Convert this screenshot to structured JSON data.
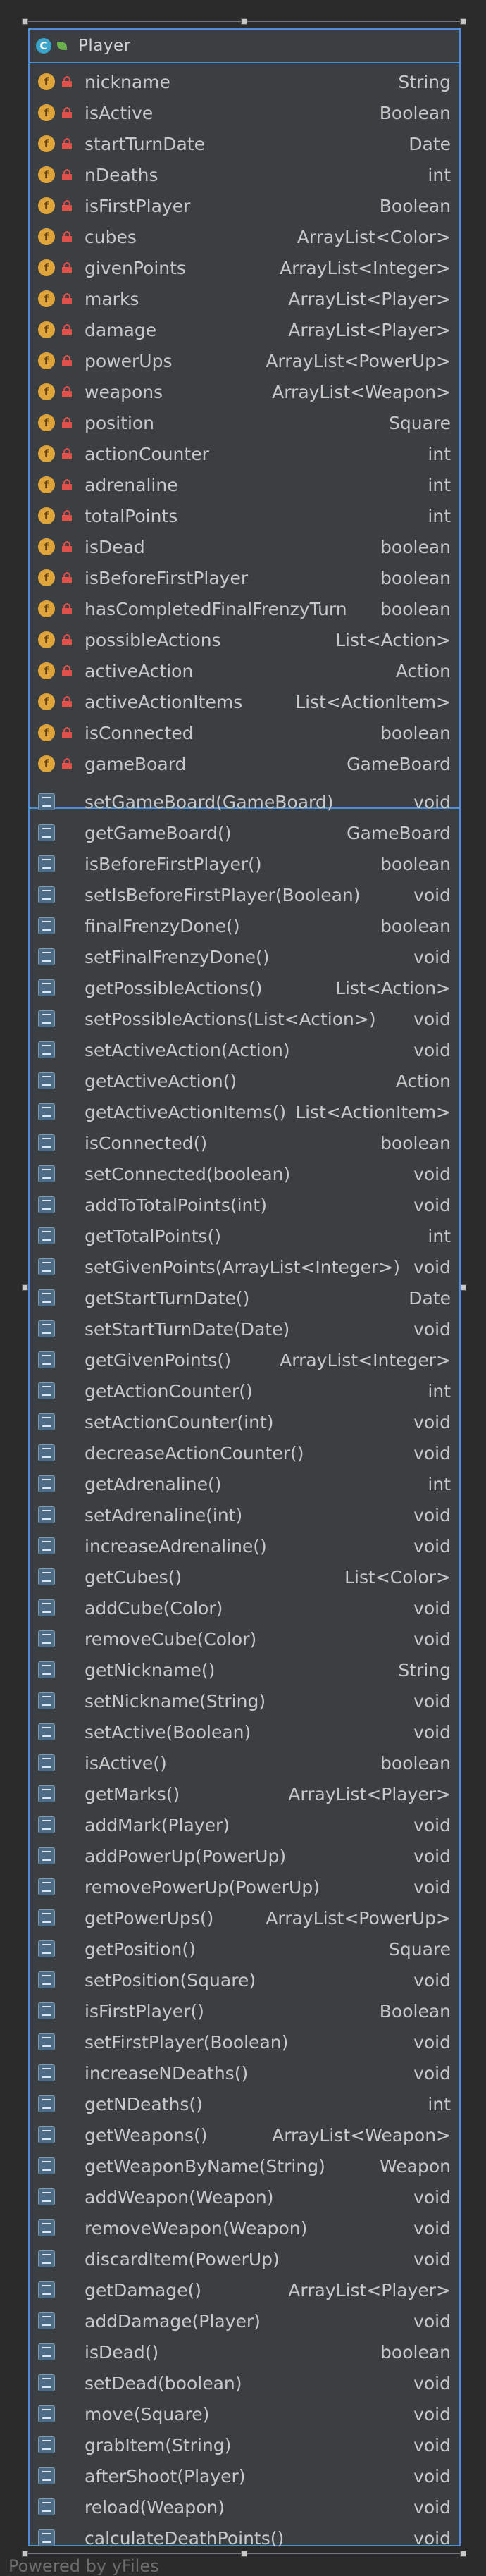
{
  "class": {
    "name": "Player",
    "icon": "class-icon",
    "fields": [
      {
        "name": "nickname",
        "type": "String"
      },
      {
        "name": "isActive",
        "type": "Boolean"
      },
      {
        "name": "startTurnDate",
        "type": "Date"
      },
      {
        "name": "nDeaths",
        "type": "int"
      },
      {
        "name": "isFirstPlayer",
        "type": "Boolean"
      },
      {
        "name": "cubes",
        "type": "ArrayList<Color>"
      },
      {
        "name": "givenPoints",
        "type": "ArrayList<Integer>"
      },
      {
        "name": "marks",
        "type": "ArrayList<Player>"
      },
      {
        "name": "damage",
        "type": "ArrayList<Player>"
      },
      {
        "name": "powerUps",
        "type": "ArrayList<PowerUp>"
      },
      {
        "name": "weapons",
        "type": "ArrayList<Weapon>"
      },
      {
        "name": "position",
        "type": "Square"
      },
      {
        "name": "actionCounter",
        "type": "int"
      },
      {
        "name": "adrenaline",
        "type": "int"
      },
      {
        "name": "totalPoints",
        "type": "int"
      },
      {
        "name": "isDead",
        "type": "boolean"
      },
      {
        "name": "isBeforeFirstPlayer",
        "type": "boolean"
      },
      {
        "name": "hasCompletedFinalFrenzyTurn",
        "type": "boolean"
      },
      {
        "name": "possibleActions",
        "type": "List<Action>"
      },
      {
        "name": "activeAction",
        "type": "Action"
      },
      {
        "name": "activeActionItems",
        "type": "List<ActionItem>"
      },
      {
        "name": "isConnected",
        "type": "boolean"
      },
      {
        "name": "gameBoard",
        "type": "GameBoard"
      }
    ],
    "methods": [
      {
        "name": "setGameBoard(GameBoard)",
        "type": "void"
      },
      {
        "name": "getGameBoard()",
        "type": "GameBoard"
      },
      {
        "name": "isBeforeFirstPlayer()",
        "type": "boolean"
      },
      {
        "name": "setIsBeforeFirstPlayer(Boolean)",
        "type": "void"
      },
      {
        "name": "finalFrenzyDone()",
        "type": "boolean"
      },
      {
        "name": "setFinalFrenzyDone()",
        "type": "void"
      },
      {
        "name": "getPossibleActions()",
        "type": "List<Action>"
      },
      {
        "name": "setPossibleActions(List<Action>)",
        "type": "void"
      },
      {
        "name": "setActiveAction(Action)",
        "type": "void"
      },
      {
        "name": "getActiveAction()",
        "type": "Action"
      },
      {
        "name": "getActiveActionItems()",
        "type": "List<ActionItem>"
      },
      {
        "name": "isConnected()",
        "type": "boolean"
      },
      {
        "name": "setConnected(boolean)",
        "type": "void"
      },
      {
        "name": "addToTotalPoints(int)",
        "type": "void"
      },
      {
        "name": "getTotalPoints()",
        "type": "int"
      },
      {
        "name": "setGivenPoints(ArrayList<Integer>)",
        "type": "void"
      },
      {
        "name": "getStartTurnDate()",
        "type": "Date"
      },
      {
        "name": "setStartTurnDate(Date)",
        "type": "void"
      },
      {
        "name": "getGivenPoints()",
        "type": "ArrayList<Integer>"
      },
      {
        "name": "getActionCounter()",
        "type": "int"
      },
      {
        "name": "setActionCounter(int)",
        "type": "void"
      },
      {
        "name": "decreaseActionCounter()",
        "type": "void"
      },
      {
        "name": "getAdrenaline()",
        "type": "int"
      },
      {
        "name": "setAdrenaline(int)",
        "type": "void"
      },
      {
        "name": "increaseAdrenaline()",
        "type": "void"
      },
      {
        "name": "getCubes()",
        "type": "List<Color>"
      },
      {
        "name": "addCube(Color)",
        "type": "void"
      },
      {
        "name": "removeCube(Color)",
        "type": "void"
      },
      {
        "name": "getNickname()",
        "type": "String"
      },
      {
        "name": "setNickname(String)",
        "type": "void"
      },
      {
        "name": "setActive(Boolean)",
        "type": "void"
      },
      {
        "name": "isActive()",
        "type": "boolean"
      },
      {
        "name": "getMarks()",
        "type": "ArrayList<Player>"
      },
      {
        "name": "addMark(Player)",
        "type": "void"
      },
      {
        "name": "addPowerUp(PowerUp)",
        "type": "void"
      },
      {
        "name": "removePowerUp(PowerUp)",
        "type": "void"
      },
      {
        "name": "getPowerUps()",
        "type": "ArrayList<PowerUp>"
      },
      {
        "name": "getPosition()",
        "type": "Square"
      },
      {
        "name": "setPosition(Square)",
        "type": "void"
      },
      {
        "name": "isFirstPlayer()",
        "type": "Boolean"
      },
      {
        "name": "setFirstPlayer(Boolean)",
        "type": "void"
      },
      {
        "name": "increaseNDeaths()",
        "type": "void"
      },
      {
        "name": "getNDeaths()",
        "type": "int"
      },
      {
        "name": "getWeapons()",
        "type": "ArrayList<Weapon>"
      },
      {
        "name": "getWeaponByName(String)",
        "type": "Weapon"
      },
      {
        "name": "addWeapon(Weapon)",
        "type": "void"
      },
      {
        "name": "removeWeapon(Weapon)",
        "type": "void"
      },
      {
        "name": "discardItem(PowerUp)",
        "type": "void"
      },
      {
        "name": "getDamage()",
        "type": "ArrayList<Player>"
      },
      {
        "name": "addDamage(Player)",
        "type": "void"
      },
      {
        "name": "isDead()",
        "type": "boolean"
      },
      {
        "name": "setDead(boolean)",
        "type": "void"
      },
      {
        "name": "move(Square)",
        "type": "void"
      },
      {
        "name": "grabItem(String)",
        "type": "void"
      },
      {
        "name": "afterShoot(Player)",
        "type": "void"
      },
      {
        "name": "reload(Weapon)",
        "type": "void"
      },
      {
        "name": "calculateDeathPoints()",
        "type": "void"
      }
    ]
  },
  "field_icon_letter": "f",
  "class_icon_letter": "C",
  "footer": "Powered by yFiles",
  "colors": {
    "background": "#2b2b2b",
    "box": "#3c3f41",
    "selection": "#4e8dd6",
    "field_icon": "#e0a53a",
    "private_lock": "#e0514b",
    "method_icon": "#4d6b85",
    "text": "#c8c8c8"
  }
}
